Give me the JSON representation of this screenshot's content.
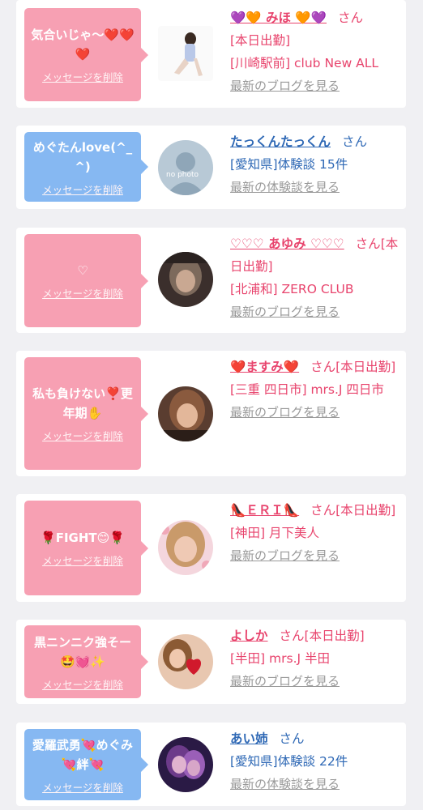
{
  "cards": [
    {
      "theme": "pink",
      "message": "気合いじゃ〜❤️❤️❤️",
      "delete_label": "メッセージを削除",
      "avatar": "photo-girl-icon",
      "name": "💜🧡 みほ 🧡💜",
      "honorific": "さん",
      "status": "[本日出勤]",
      "detail": "[川崎駅前] club New ALL",
      "link_label": "最新のブログを見る"
    },
    {
      "theme": "blue",
      "message": "めぐたんlove(^_^)",
      "delete_label": "メッセージを削除",
      "avatar": "no-photo-icon",
      "avatar_text": "no photo",
      "name": "たっくんたっくん",
      "honorific": "さん",
      "status": "",
      "detail": "[愛知県]体験談 15件",
      "link_label": "最新の体験談を見る"
    },
    {
      "theme": "pink",
      "message": "♡",
      "delete_label": "メッセージを削除",
      "avatar": "photo-dark-icon",
      "name": "♡♡♡ あゆみ ♡♡♡",
      "honorific": "さん",
      "status": "[本日出勤]",
      "detail": "[北浦和] ZERO CLUB",
      "link_label": "最新のブログを見る"
    },
    {
      "theme": "pink",
      "message": "私も負けない❣️更年期✋",
      "delete_label": "メッセージを削除",
      "avatar": "photo-selfie-icon",
      "name": "❤️ますみ❤️",
      "honorific": "さん",
      "status": "[本日出勤]",
      "detail": "[三重 四日市] mrs.J 四日市",
      "link_label": "最新のブログを見る"
    },
    {
      "theme": "pink",
      "message": "🌹FIGHT😊🌹",
      "delete_label": "メッセージを削除",
      "avatar": "photo-blonde-icon",
      "name": "👠ＥＲＩ👠",
      "honorific": "さん",
      "status": "[本日出勤]",
      "detail": "[神田] 月下美人",
      "link_label": "最新のブログを見る"
    },
    {
      "theme": "pink",
      "message": "黒ニンニク強そー🤩💓✨",
      "delete_label": "メッセージを削除",
      "avatar": "photo-heart-balloon-icon",
      "name": "よしか",
      "honorific": "さん",
      "status": "[本日出勤]",
      "detail": "[半田] mrs.J 半田",
      "link_label": "最新のブログを見る"
    },
    {
      "theme": "blue",
      "message": "愛羅武勇💘めぐみ💘絆💘",
      "delete_label": "メッセージを削除",
      "avatar": "photo-purple-icon",
      "name": "あい姉",
      "honorific": "さん",
      "status": "",
      "detail": "[愛知県]体験談 22件",
      "link_label": "最新の体験談を見る"
    }
  ]
}
